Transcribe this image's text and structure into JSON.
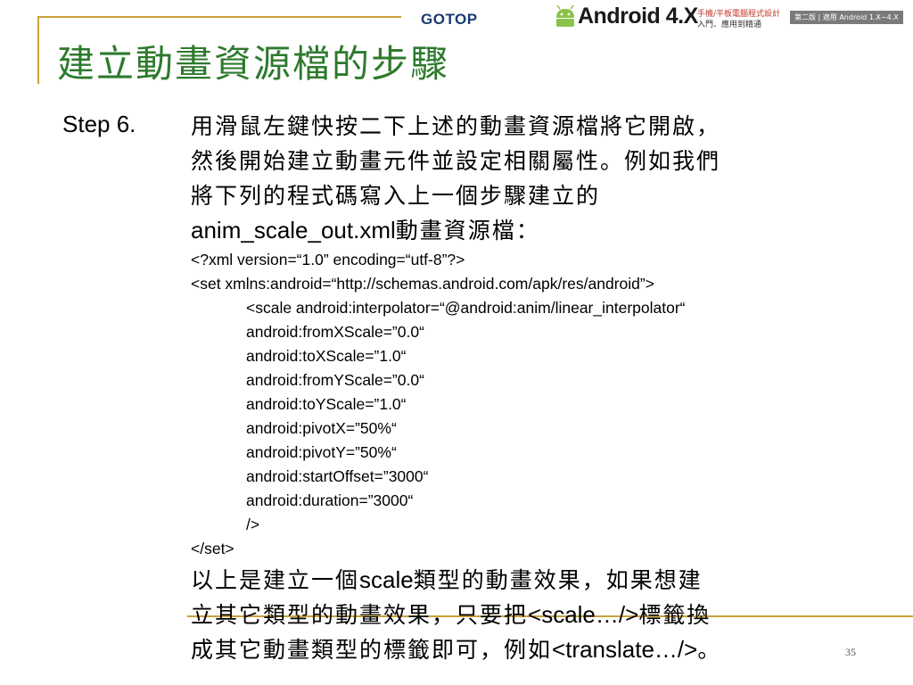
{
  "header": {
    "publisher": "GOTOP",
    "book_title": "Android 4.X",
    "book_subtitle_line1": "手機/平板電腦程式設計",
    "book_subtitle_line2": "入門、應用到精通",
    "edition_badge": "第二版 | 適用 Android 1.X~4.X"
  },
  "slide": {
    "title": "建立動畫資源檔的步驟",
    "step_label": "Step 6.",
    "intro_lines": [
      "用滑鼠左鍵快按二下上述的動畫資源檔將它開啟，",
      "然後開始建立動畫元件並設定相關屬性。例如我們",
      "將下列的程式碼寫入上一個步驟建立的"
    ],
    "intro_filename": "anim_scale_out.xml",
    "intro_suffix": "動畫資源檔：",
    "code_lines": [
      "<?xml version=“1.0” encoding=“utf-8”?>",
      "<set xmlns:android=“http://schemas.android.com/apk/res/android”>",
      "<scale android:interpolator=“@android:anim/linear_interpolator“",
      "android:fromXScale=”0.0“",
      "android:toXScale=”1.0“",
      "android:fromYScale=”0.0“",
      "android:toYScale=”1.0“",
      "android:pivotX=”50%“",
      "android:pivotY=”50%“",
      "android:startOffset=”3000“",
      "android:duration=”3000“",
      "/>",
      "</set>"
    ],
    "outro_line1_a": "以上是建立一個",
    "outro_line1_b": "scale",
    "outro_line1_c": "類型的動畫效果，如果想建",
    "outro_line2_a": "立其它類型的動畫效果，只要把",
    "outro_line2_b": "<scale…/>",
    "outro_line2_c": "標籤換",
    "outro_line3_a": "成其它動畫類型的標籤即可，例如",
    "outro_line3_b": "<translate…/>",
    "outro_line3_c": "。",
    "page_number": "35"
  }
}
